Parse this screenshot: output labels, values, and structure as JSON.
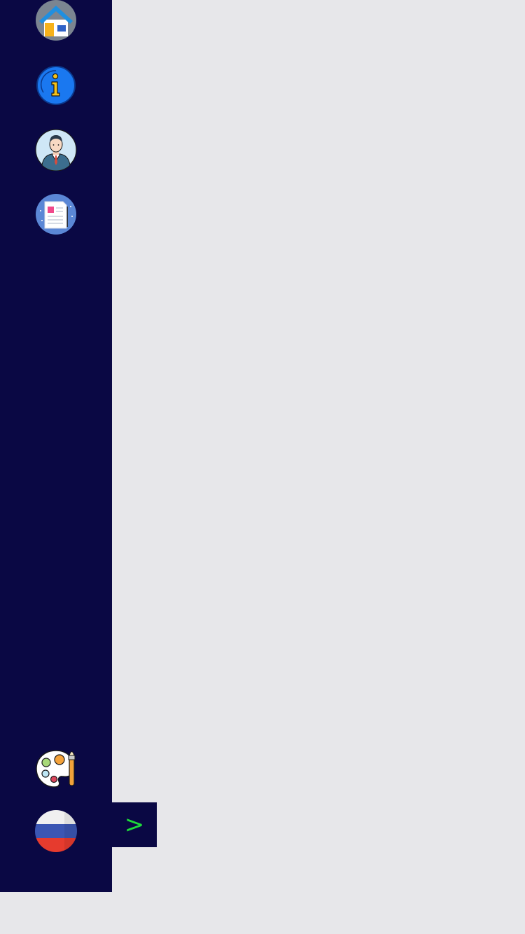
{
  "sidebar": {
    "items": [
      {
        "name": "home",
        "icon": "home-icon"
      },
      {
        "name": "info",
        "icon": "info-icon"
      },
      {
        "name": "profile",
        "icon": "businessman-icon"
      },
      {
        "name": "documents",
        "icon": "document-icon"
      }
    ],
    "bottom": [
      {
        "name": "theme",
        "icon": "palette-icon"
      },
      {
        "name": "language",
        "icon": "russian-flag-icon"
      }
    ]
  },
  "toggle": {
    "icon": "chevron-right-icon",
    "glyph": ">",
    "color": "#1edc3a"
  },
  "colors": {
    "sidebar_background": "#0a0844",
    "content_background": "#e7e7ea"
  }
}
